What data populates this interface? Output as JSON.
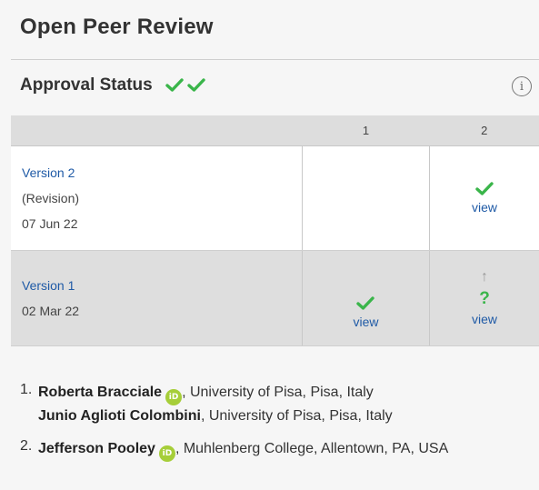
{
  "header": {
    "title": "Open Peer Review",
    "approval_label": "Approval Status"
  },
  "colors": {
    "approved": "#3ab54a",
    "link": "#1f5aa6",
    "orcid": "#a6ce39"
  },
  "table": {
    "columns": [
      "",
      "1",
      "2"
    ],
    "rows": [
      {
        "version": "Version 2",
        "note": "(Revision)",
        "date": "07 Jun 22",
        "reviews": [
          {
            "status": "none"
          },
          {
            "status": "approved",
            "icon": "check-icon",
            "link": "view"
          }
        ]
      },
      {
        "version": "Version 1",
        "date": "02 Mar 22",
        "reviews": [
          {
            "status": "approved",
            "icon": "check-icon",
            "link": "view"
          },
          {
            "status": "approved-with-reservations",
            "icon": "question-icon",
            "symbol": "?",
            "arrow": "↑",
            "link": "view"
          }
        ]
      }
    ]
  },
  "reviewers": [
    {
      "number": "1.",
      "people": [
        {
          "name": "Roberta Bracciale",
          "orcid": true,
          "orcid_text": "iD",
          "affiliation": ", University of Pisa, Pisa, Italy"
        },
        {
          "name": "Junio Aglioti Colombini",
          "orcid": false,
          "affiliation": ", University of Pisa, Pisa, Italy"
        }
      ]
    },
    {
      "number": "2.",
      "people": [
        {
          "name": "Jefferson Pooley",
          "orcid": true,
          "orcid_text": "iD",
          "affiliation": ", Muhlenberg College, Allentown, PA, USA"
        }
      ]
    }
  ]
}
